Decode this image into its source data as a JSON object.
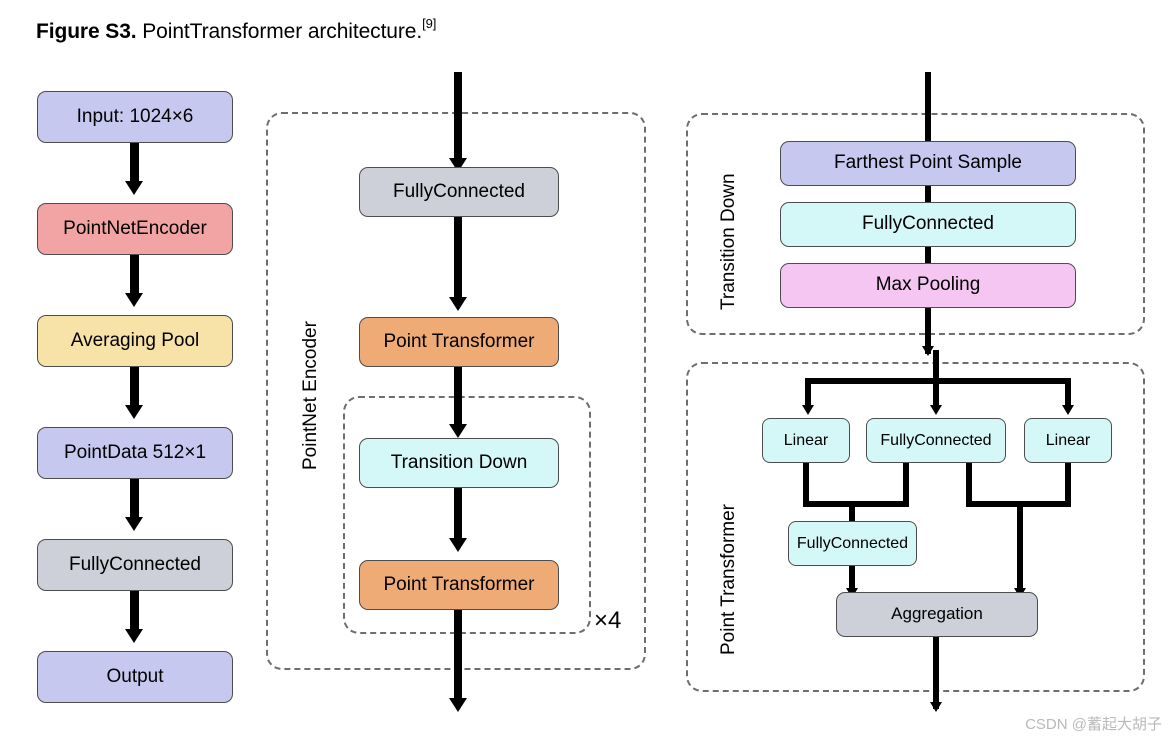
{
  "caption": {
    "bold": "Figure S3.",
    "text": " PointTransformer architecture.",
    "ref": "[9]"
  },
  "colors": {
    "lavender": "#c6c8ef",
    "salmon": "#f2a3a3",
    "cream": "#f7e2a8",
    "gray": "#cdd0d8",
    "orange": "#eeab76",
    "cyan": "#d4f7f7",
    "pink": "#f5c6f2",
    "node_border": "#4d4d4d",
    "group_border": "#6e6e6e",
    "line": "#000000",
    "watermark": "#b9b9b9"
  },
  "left_column": {
    "name": "main-pipeline",
    "nodes": [
      {
        "id": "input",
        "label": "Input: 1024×6",
        "color": "lavender"
      },
      {
        "id": "pointnet-encoder",
        "label": "PointNetEncoder",
        "color": "salmon"
      },
      {
        "id": "averaging-pool",
        "label": "Averaging  Pool",
        "color": "cream"
      },
      {
        "id": "point-data",
        "label": "PointData 512×1",
        "color": "lavender"
      },
      {
        "id": "fully-connected",
        "label": "FullyConnected",
        "color": "gray"
      },
      {
        "id": "output",
        "label": "Output",
        "color": "lavender"
      }
    ]
  },
  "middle_column": {
    "group_label": "PointNet  Encoder",
    "nodes": [
      {
        "id": "fully-connected",
        "label": "FullyConnected",
        "color": "gray"
      },
      {
        "id": "point-transformer",
        "label": "Point Transformer",
        "color": "orange"
      }
    ],
    "repeat_block": {
      "multiplier": "×4",
      "nodes": [
        {
          "id": "transition-down",
          "label": "Transition Down",
          "color": "cyan"
        },
        {
          "id": "point-transformer",
          "label": "Point Transformer",
          "color": "orange"
        }
      ]
    }
  },
  "right_top": {
    "group_label": "Transition Down",
    "nodes": [
      {
        "id": "farthest-point-sample",
        "label": "Farthest Point Sample",
        "color": "lavender"
      },
      {
        "id": "fully-connected",
        "label": "FullyConnected",
        "color": "cyan"
      },
      {
        "id": "max-pooling",
        "label": "Max Pooling",
        "color": "pink"
      }
    ]
  },
  "right_bottom": {
    "group_label": "Point Transformer",
    "branch_nodes": [
      {
        "id": "linear-left",
        "label": "Linear",
        "color": "cyan"
      },
      {
        "id": "fully-connected",
        "label": "FullyConnected",
        "color": "cyan"
      },
      {
        "id": "linear-right",
        "label": "Linear",
        "color": "cyan"
      }
    ],
    "merge_node": {
      "id": "fully-connected-merge",
      "label": "FullyConnected",
      "color": "cyan"
    },
    "output_node": {
      "id": "aggregation",
      "label": "Aggregation",
      "color": "gray"
    }
  },
  "watermark": "CSDN @蓄起大胡子"
}
